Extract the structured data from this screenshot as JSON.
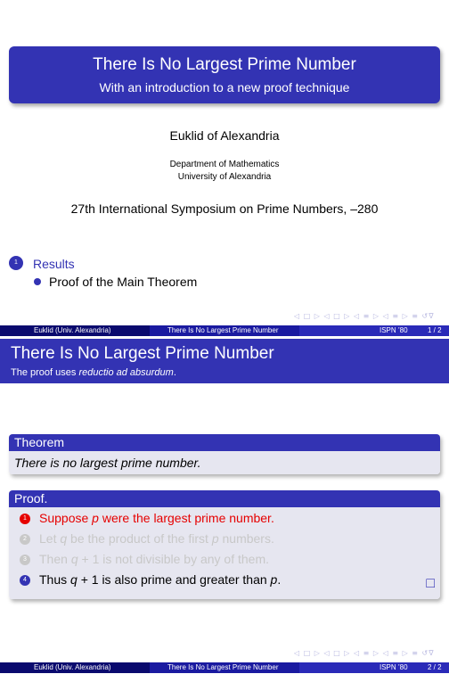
{
  "slide1": {
    "title": "There Is No Largest Prime Number",
    "subtitle": "With an introduction to a new proof technique",
    "author": "Euklid of Alexandria",
    "institute_line1": "Department of Mathematics",
    "institute_line2": "University of Alexandria",
    "date": "27th International Symposium on Prime Numbers, –280",
    "toc": {
      "section_number": "1",
      "section": "Results",
      "subsection": "Proof of the Main Theorem"
    }
  },
  "navigation_symbols": "◁ □ ▷ ◁ □ ▷ ◁ ≡ ▷ ◁ ≡ ▷ ≡ ↺∇",
  "footer": {
    "author": "Euklid  (Univ. Alexandria)",
    "title": "There Is No Largest Prime Number",
    "conf": "ISPN ’80",
    "page1": "1 / 2",
    "page2": "2 / 2"
  },
  "slide2": {
    "frametitle": "There Is No Largest Prime Number",
    "framesubtitle_prefix": "The proof uses ",
    "framesubtitle_emph": "reductio ad absurdum",
    "framesubtitle_suffix": ".",
    "theorem": {
      "heading": "Theorem",
      "body": "There is no largest prime number."
    },
    "proof": {
      "heading": "Proof.",
      "items": [
        {
          "num": "1",
          "pre": "Suppose ",
          "var": "p",
          "post": " were the largest prime number.",
          "state": "alert"
        },
        {
          "num": "2",
          "pre": "Let ",
          "var": "q",
          "post": " be the product of the first ",
          "var2": "p",
          "post2": " numbers.",
          "state": "dim"
        },
        {
          "num": "3",
          "pre": "Then ",
          "var": "q",
          "post": " + 1 is not divisible by any of them.",
          "state": "dim"
        },
        {
          "num": "4",
          "pre": "Thus ",
          "var": "q",
          "post": " + 1 is also prime and greater than ",
          "var2": "p",
          "post2": ".",
          "state": "normal"
        }
      ],
      "qed": "□"
    }
  },
  "colors": {
    "structure": "#3333b3",
    "alert": "#e60000",
    "dim": "#c8c8c8",
    "block_body": "#e6e6f0"
  }
}
